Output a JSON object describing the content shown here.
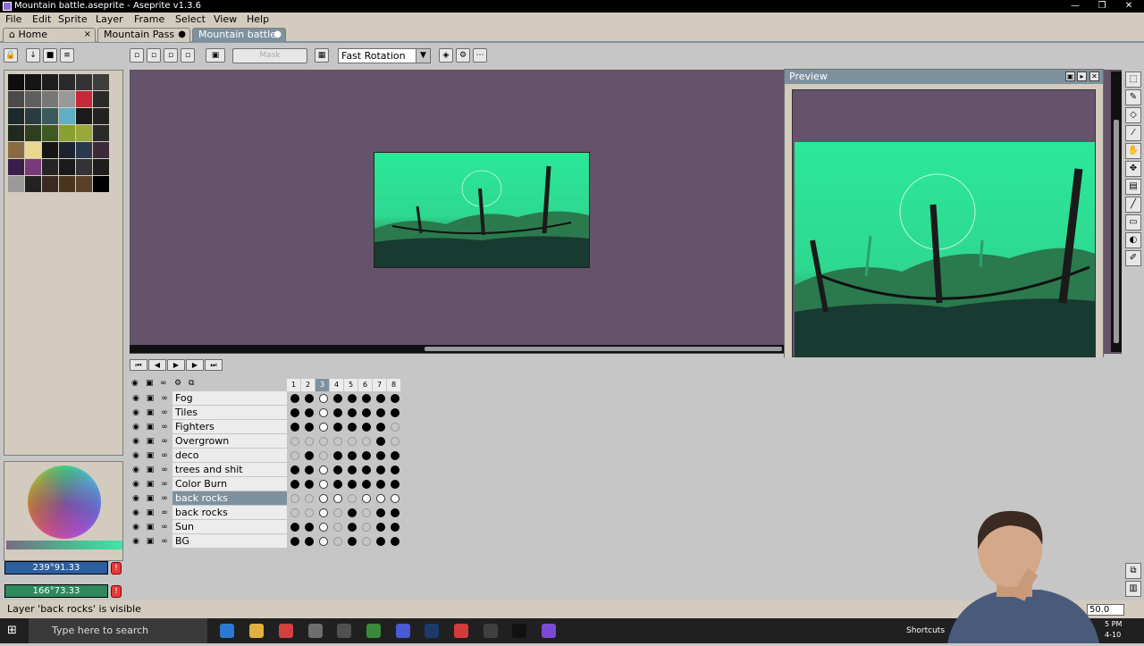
{
  "window": {
    "title": "Mountain battle.aseprite - Aseprite v1.3.6"
  },
  "menu": [
    "File",
    "Edit",
    "Sprite",
    "Layer",
    "Frame",
    "Select",
    "View",
    "Help"
  ],
  "tabs": [
    {
      "label": "Home",
      "close": "×"
    },
    {
      "label": "Mountain Pass",
      "close": "●"
    },
    {
      "label": "Mountain battle",
      "close": "●"
    }
  ],
  "toolbar": {
    "rotation_mode": "Fast Rotation",
    "mask_label": "Mask"
  },
  "preview": {
    "title": "Preview"
  },
  "colors": {
    "fg_value": "239°91.33",
    "bg_value": "166°73.33",
    "fg_color": "#2b5fa0",
    "bg_color": "#2e8a5e"
  },
  "palette": [
    "#0e0e0e",
    "#151515",
    "#1e1e1e",
    "#2a2a2a",
    "#333333",
    "#3d3d3d",
    "#4a4a4a",
    "#5f5f5f",
    "#777777",
    "#999999",
    "#c8283a",
    "#2a2a2a",
    "#1c2a2e",
    "#2a3c40",
    "#3a5a5e",
    "#5fb0c0",
    "#1a1a1a",
    "#222222",
    "#1e2a1e",
    "#2e3e20",
    "#3e5a22",
    "#8aa030",
    "#9aa83a",
    "#2a2a2a",
    "#8a6a40",
    "#e8d890",
    "#151515",
    "#1c2430",
    "#2a3a4e",
    "#3a2a3a",
    "#3a1e4a",
    "#7a3a7a",
    "#252525",
    "#1a1a1a",
    "#333338",
    "#1e1e1e",
    "#9a9a9a",
    "#222222",
    "#3a2a22",
    "#4a3420",
    "#5a4028",
    "#000000"
  ],
  "timeline": {
    "frames": [
      "1",
      "2",
      "3",
      "4",
      "5",
      "6",
      "7",
      "8"
    ],
    "current_frame_index": 2,
    "layers": [
      {
        "name": "Fog",
        "cels": "FFWFFFFF"
      },
      {
        "name": "Tiles",
        "cels": "FFWFFFFF"
      },
      {
        "name": "Fighters",
        "cels": "FFWFFFFE"
      },
      {
        "name": "Overgrown",
        "cels": "EEEEEEFE"
      },
      {
        "name": "deco",
        "cels": "EFEFFFFF"
      },
      {
        "name": "trees and shit",
        "cels": "FFWFFFFF"
      },
      {
        "name": "Color Burn",
        "cels": "FFWFFFFF"
      },
      {
        "name": "back rocks",
        "cels": "EEWWEWWW",
        "selected": true
      },
      {
        "name": "back rocks",
        "cels": "EEWEFEFF"
      },
      {
        "name": "Sun",
        "cels": "FFWEFEFF"
      },
      {
        "name": "BG",
        "cels": "FFWEFEFF"
      }
    ]
  },
  "status": {
    "message": "Layer 'back rocks' is visible",
    "zoom": "50.0"
  },
  "taskbar": {
    "search_placeholder": "Type here to search",
    "tray_label": "Shortcuts",
    "clock_line1": "5 PM",
    "clock_line2": "4-10"
  },
  "window_controls": {
    "min": "—",
    "max": "❐",
    "close": "✕"
  }
}
